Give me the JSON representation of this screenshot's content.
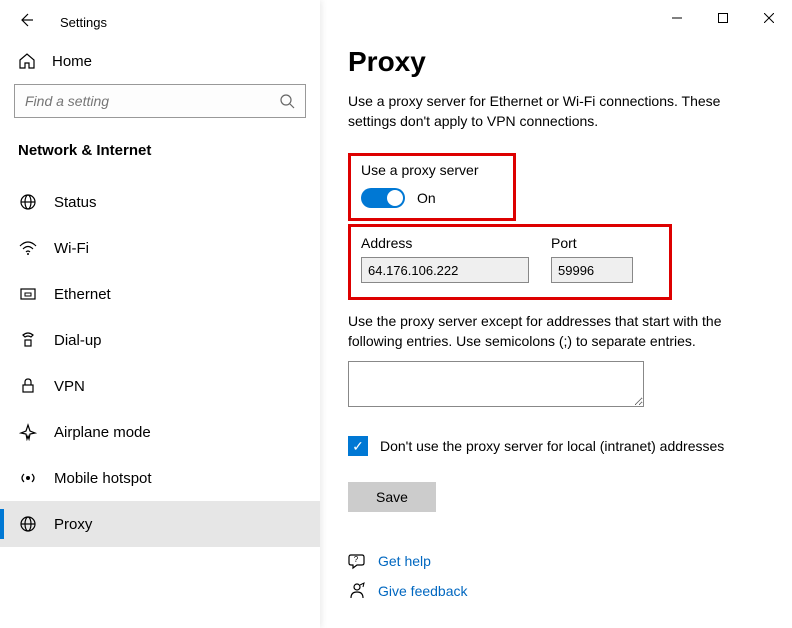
{
  "window": {
    "title": "Settings"
  },
  "sidebar": {
    "home_label": "Home",
    "search_placeholder": "Find a setting",
    "section_heading": "Network & Internet",
    "items": [
      {
        "label": "Status"
      },
      {
        "label": "Wi-Fi"
      },
      {
        "label": "Ethernet"
      },
      {
        "label": "Dial-up"
      },
      {
        "label": "VPN"
      },
      {
        "label": "Airplane mode"
      },
      {
        "label": "Mobile hotspot"
      },
      {
        "label": "Proxy"
      }
    ]
  },
  "main": {
    "page_title": "Proxy",
    "description": "Use a proxy server for Ethernet or Wi-Fi connections. These settings don't apply to VPN connections.",
    "use_proxy_label": "Use a proxy server",
    "toggle_state": "On",
    "address_label": "Address",
    "address_value": "64.176.106.222",
    "port_label": "Port",
    "port_value": "59996",
    "exceptions_text": "Use the proxy server except for addresses that start with the following entries. Use semicolons (;) to separate entries.",
    "exceptions_value": "",
    "local_bypass_label": "Don't use the proxy server for local (intranet) addresses",
    "local_bypass_checked": true,
    "save_label": "Save",
    "help_link": "Get help",
    "feedback_link": "Give feedback"
  }
}
